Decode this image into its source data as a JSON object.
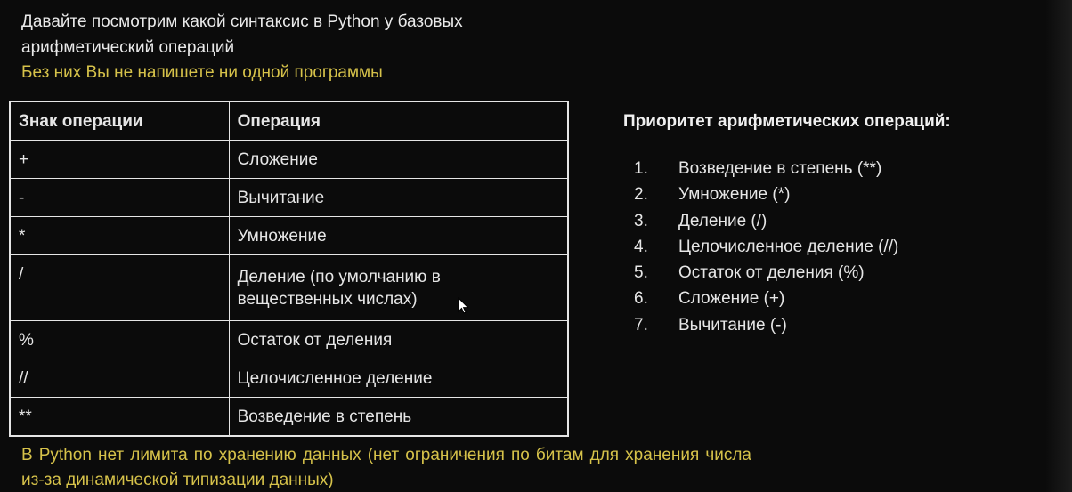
{
  "title": "Давайте посмотрим какой синтаксис в Python у базовых арифметический операций",
  "subtitle": "Без них Вы не напишете ни одной программы",
  "table": {
    "headers": [
      "Знак операции",
      "Операция"
    ],
    "rows": [
      {
        "sign": "+",
        "operation": "Сложение"
      },
      {
        "sign": "-",
        "operation": "Вычитание"
      },
      {
        "sign": "*",
        "operation": "Умножение"
      },
      {
        "sign": "/",
        "operation": "Деление (по умолчанию в вещественных числах)"
      },
      {
        "sign": "%",
        "operation": "Остаток от деления"
      },
      {
        "sign": "//",
        "operation": "Целочисленное деление"
      },
      {
        "sign": "**",
        "operation": "Возведение в степень"
      }
    ]
  },
  "priority": {
    "title": "Приоритет арифметических операций:",
    "items": [
      {
        "num": "1.",
        "label": "Возведение в степень (**)"
      },
      {
        "num": "2.",
        "label": "Умножение (*)"
      },
      {
        "num": "3.",
        "label": "Деление (/)"
      },
      {
        "num": "4.",
        "label": "Целочисленное деление (//)"
      },
      {
        "num": "5.",
        "label": "Остаток от деления (%)"
      },
      {
        "num": "6.",
        "label": "Сложение (+)"
      },
      {
        "num": "7.",
        "label": "Вычитание (-)"
      }
    ]
  },
  "footer_note": "В Python нет лимита по хранению данных (нет ограничения по битам для хранения числа из-за динамической типизации данных)",
  "colors": {
    "background": "#0b0b0b",
    "text": "#e6e6e6",
    "accent_yellow": "#d6c24a"
  },
  "icons": {
    "cursor": "mouse-pointer-icon"
  }
}
